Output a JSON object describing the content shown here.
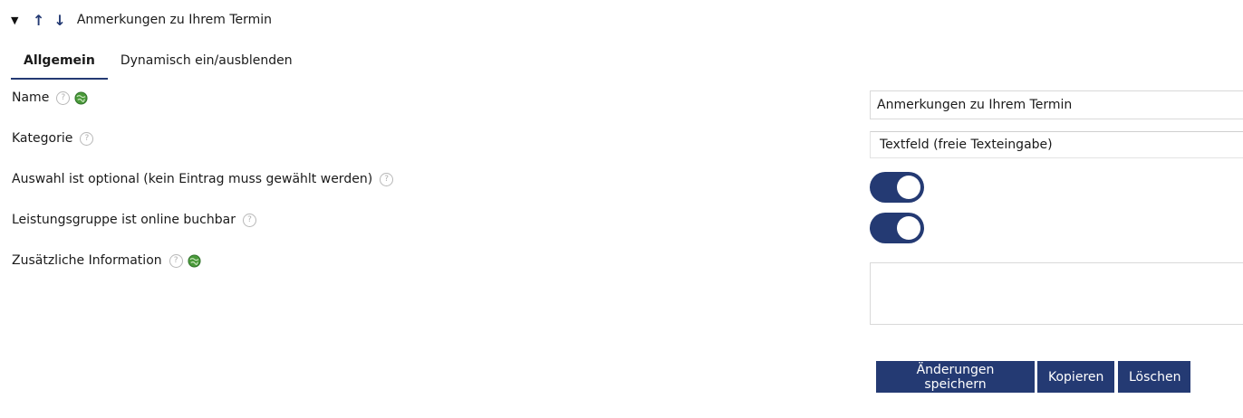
{
  "section": {
    "collapse_glyph": "▼",
    "up_arrow": "↑",
    "down_arrow": "↓",
    "title": "Anmerkungen zu Ihrem Termin"
  },
  "tabs": [
    {
      "label": "Allgemein",
      "active": true
    },
    {
      "label": "Dynamisch ein/ausblenden",
      "active": false
    }
  ],
  "form": {
    "name_label": "Name",
    "name_value": "Anmerkungen zu Ihrem Termin",
    "category_label": "Kategorie",
    "category_value": "Textfeld (freie Texteingabe)",
    "optional_label": "Auswahl ist optional (kein Eintrag muss gewählt werden)",
    "optional_on": true,
    "online_label": "Leistungsgruppe ist online buchbar",
    "online_on": true,
    "info_label": "Zusätzliche Information",
    "info_value": ""
  },
  "icons": {
    "help": "?",
    "globe": "globe-icon"
  },
  "buttons": {
    "save": "Änderungen speichern",
    "copy": "Kopieren",
    "delete": "Löschen"
  },
  "colors": {
    "accent": "#243a73",
    "border": "#d9d9d9",
    "help_icon": "#b8b8b8",
    "globe": "#4a9a3a"
  }
}
